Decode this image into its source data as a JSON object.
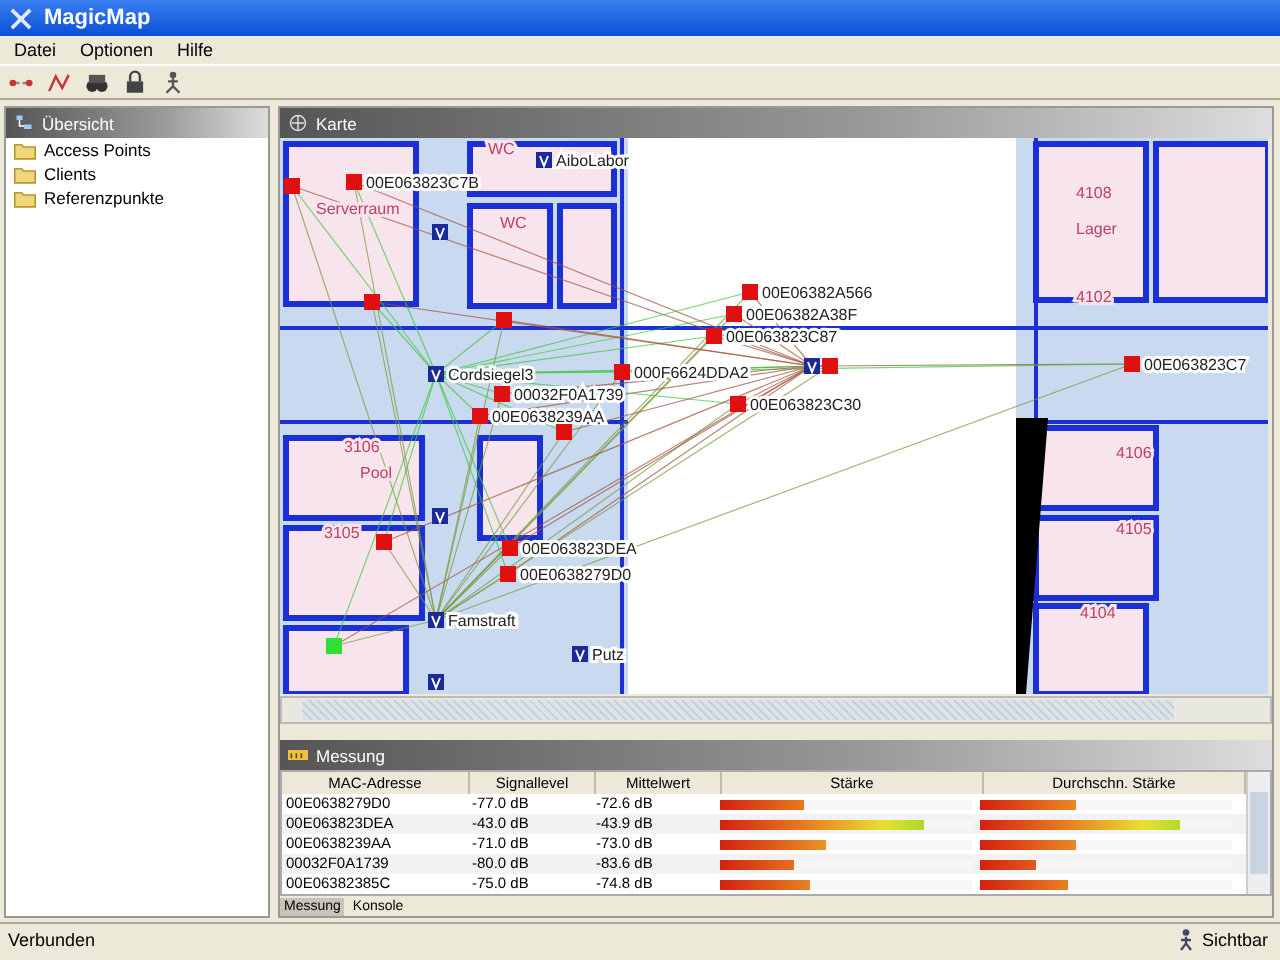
{
  "window": {
    "title": "MagicMap"
  },
  "menu": [
    "Datei",
    "Optionen",
    "Hilfe"
  ],
  "sidebar": {
    "title": "Übersicht",
    "items": [
      {
        "label": "Access Points"
      },
      {
        "label": "Clients"
      },
      {
        "label": "Referenzpunkte"
      }
    ]
  },
  "map": {
    "title": "Karte",
    "rooms": [
      "Serverraum",
      "WC",
      "WC",
      "3106",
      "Pool",
      "3105",
      "4108",
      "Lager",
      "4102",
      "4106",
      "4105",
      "4104"
    ],
    "nodes": [
      {
        "kind": "access_point",
        "label": "AiboLabor"
      },
      {
        "kind": "access_point"
      },
      {
        "kind": "access_point",
        "label": "Cordsiegel3"
      },
      {
        "kind": "access_point"
      },
      {
        "kind": "access_point",
        "label": "Famstraft"
      },
      {
        "kind": "access_point",
        "label": "Putz"
      },
      {
        "kind": "access_point"
      },
      {
        "kind": "access_point"
      },
      {
        "kind": "client",
        "label": "00E063823C7B"
      },
      {
        "kind": "client"
      },
      {
        "kind": "client",
        "label": "00E06382A566"
      },
      {
        "kind": "client",
        "label": "00E06382A38F"
      },
      {
        "kind": "client",
        "label": "00E063823C87"
      },
      {
        "kind": "client",
        "label": "000F6624DDA2"
      },
      {
        "kind": "client",
        "label": "00E063823C7"
      },
      {
        "kind": "client",
        "label": "00032F0A1739"
      },
      {
        "kind": "client",
        "label": "00E0638239AA"
      },
      {
        "kind": "client",
        "label": "00E063823C30"
      },
      {
        "kind": "client",
        "label": "00E063823DEA"
      },
      {
        "kind": "client",
        "label": "00E0638279D0"
      },
      {
        "kind": "client"
      },
      {
        "kind": "client"
      },
      {
        "kind": "reference"
      },
      {
        "kind": "client"
      },
      {
        "kind": "client"
      },
      {
        "kind": "client"
      }
    ]
  },
  "measurement": {
    "title": "Messung",
    "columns": [
      "MAC-Adresse",
      "Signallevel",
      "Mittelwert",
      "Stärke",
      "Durchschn. Stärke"
    ],
    "rows": [
      {
        "mac": "00E0638279D0",
        "signal": "-77.0 dB",
        "mean": "-72.6 dB",
        "strength": {
          "level": 0.33
        },
        "avg_strength": {
          "level": 0.38
        }
      },
      {
        "mac": "00E063823DEA",
        "signal": "-43.0 dB",
        "mean": "-43.9 dB",
        "strength": {
          "level": 0.81
        },
        "avg_strength": {
          "level": 0.79
        }
      },
      {
        "mac": "00E0638239AA",
        "signal": "-71.0 dB",
        "mean": "-73.0 dB",
        "strength": {
          "level": 0.42
        },
        "avg_strength": {
          "level": 0.38
        }
      },
      {
        "mac": "00032F0A1739",
        "signal": "-80.0 dB",
        "mean": "-83.6 dB",
        "strength": {
          "level": 0.29
        },
        "avg_strength": {
          "level": 0.22
        }
      },
      {
        "mac": "00E06382385C",
        "signal": "-75.0 dB",
        "mean": "-74.8 dB",
        "strength": {
          "level": 0.36
        },
        "avg_strength": {
          "level": 0.35
        }
      }
    ],
    "tabs": [
      {
        "label": "Messung",
        "selected": true
      },
      {
        "label": "Konsole",
        "selected": false
      }
    ]
  },
  "status_bar": {
    "left": "Verbunden",
    "right": "Sichtbar"
  }
}
